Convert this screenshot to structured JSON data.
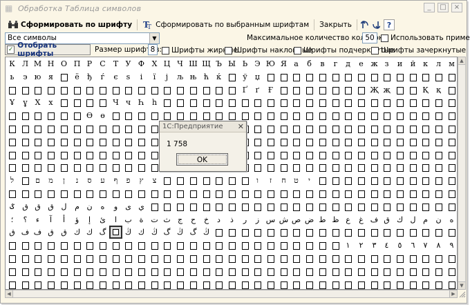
{
  "window": {
    "title": "Обработка  Таблица символов",
    "buttons": [
      "_",
      "□",
      "×"
    ]
  },
  "toolbar": {
    "generate_by_font_label": "Сформировать по шрифту",
    "generate_by_selected_label": "Сформировать по выбранным шрифтам",
    "close_label": "Закрыть",
    "help_label": "?"
  },
  "filter": {
    "symbols_combo_value": "Все символы",
    "max_columns_label": "Максимальное количество колонок:",
    "max_columns_value": "50",
    "use_note_label": "Использовать примечание",
    "select_fonts_label": "Отобрать шрифты",
    "font_size_label": "Размер шрифтов:",
    "font_size_value": "8",
    "bold_label": "Шрифты жирные",
    "italic_label": "Шрифты наклонные",
    "underline_label": "Шрифты подчеркнутые",
    "strike_label": "Шрифты зачеркнутые"
  },
  "grid": {
    "rows": [
      [
        "К",
        "Л",
        "М",
        "Н",
        "О",
        "П",
        "Р",
        "С",
        "Т",
        "У",
        "Ф",
        "Х",
        "Ц",
        "Ч",
        "Ш",
        "Щ",
        "Ъ",
        "Ы",
        "Ь",
        "Э",
        "Ю",
        "Я",
        "а",
        "б",
        "в",
        "г",
        "д",
        "е",
        "ж",
        "з",
        "и",
        "й",
        "к",
        "л",
        "м"
      ],
      [
        "ь",
        "э",
        "ю",
        "я",
        "□",
        "ё",
        "ђ",
        "ѓ",
        "є",
        "ѕ",
        "і",
        "ї",
        "ј",
        "љ",
        "њ",
        "ћ",
        "ќ",
        "□",
        "ў",
        "џ",
        "□",
        "□",
        "□",
        "□",
        "□",
        "□",
        "□",
        "□",
        "□",
        "□",
        "□",
        "□",
        "□",
        "□",
        "□"
      ],
      [
        "□",
        "□",
        "□",
        "□",
        "□",
        "□",
        "□",
        "□",
        "□",
        "□",
        "□",
        "□",
        "□",
        "□",
        "□",
        "□",
        "□",
        "□",
        "Ґ",
        "ґ",
        "Ғ",
        "□",
        "□",
        "□",
        "□",
        "□",
        "□",
        "□",
        "Җ",
        "җ",
        "□",
        "□",
        "Қ",
        "қ",
        "□"
      ],
      [
        "Ұ",
        "ұ",
        "Х",
        "х",
        "□",
        "□",
        "□",
        "□",
        "Ч",
        "ч",
        "Һ",
        "һ",
        "□",
        "□",
        "□",
        "□",
        "□",
        "□",
        "□",
        "□",
        "□",
        "□",
        "□",
        "□",
        "□",
        "□",
        "□",
        "□",
        "□",
        "□",
        "□",
        "□",
        "□",
        "□",
        "□"
      ],
      [
        "□",
        "□",
        "□",
        "□",
        "□",
        "□",
        "Ө",
        "ө",
        "□",
        "□",
        "□",
        "□",
        "□",
        "□",
        "□",
        "□",
        "□",
        "□",
        "□",
        "□",
        "□",
        "□",
        "□",
        "□",
        "□",
        "□",
        "□",
        "□",
        "□",
        "□",
        "□",
        "□",
        "□",
        "□",
        "□"
      ],
      [
        "□",
        "□",
        "□",
        "□",
        "□",
        "□",
        "□",
        "□",
        "□",
        "□",
        "□",
        "□",
        "□",
        "□",
        "□",
        "□",
        "□",
        "□",
        "□",
        "□",
        "□",
        "□",
        "□",
        "□",
        "□",
        "□",
        "□",
        "□",
        "□",
        "□",
        "□",
        "□",
        "□",
        "□",
        "□"
      ],
      [
        "□",
        "□",
        "□",
        "□",
        "□",
        "□",
        "□",
        "□",
        "□",
        "□",
        "□",
        "□",
        "□",
        "□",
        "□",
        "□",
        "□",
        "□",
        "□",
        "□",
        "□",
        "□",
        "□",
        "□",
        "□",
        "□",
        "□",
        "□",
        "□",
        "□",
        "□",
        "□",
        "□",
        "□",
        "□"
      ],
      [
        "□",
        "□",
        "□",
        "□",
        "□",
        "□",
        "□",
        "□",
        "□",
        "□",
        "□",
        "□",
        "□",
        "□",
        "□",
        "□",
        "□",
        "□",
        "□",
        "□",
        "□",
        "□",
        "□",
        "□",
        "□",
        "□",
        "□",
        "□",
        "□",
        "□",
        "□",
        "□",
        "□",
        "□",
        "□"
      ],
      [
        "□",
        "□",
        "□",
        "□",
        "□",
        "□",
        "□",
        "□",
        "□",
        "□",
        "□",
        "□",
        "□",
        "□",
        "□",
        "□",
        "□",
        "□",
        "□",
        "□",
        "□",
        "□",
        "□",
        "□",
        "□",
        "□",
        "□",
        "□",
        "□",
        "□",
        "□",
        "□",
        "□",
        "□",
        "□"
      ],
      [
        "ל",
        "□",
        "ם",
        "מ",
        "ן",
        "נ",
        "ס",
        "ע",
        "ף",
        "פ",
        "ץ",
        "צ",
        "□",
        "□",
        "□",
        "□",
        "□",
        "□",
        "□",
        "ו",
        "ז",
        "ח",
        "ט",
        "י",
        "□",
        "□",
        "□",
        "□",
        "□",
        "□",
        "□",
        "□",
        "□",
        "□",
        "□"
      ],
      [
        "□",
        "□",
        "□",
        "□",
        "□",
        "□",
        "□",
        "□",
        "□",
        "□",
        "□",
        "□",
        "□",
        "□",
        "□",
        "□",
        "□",
        "□",
        "□",
        "□",
        "□",
        "□",
        "□",
        "□",
        "□",
        "□",
        "□",
        "□",
        "□",
        "□",
        "□",
        "□",
        "□",
        "□",
        "□"
      ],
      [
        "ػ",
        "ق",
        "ق",
        "ق",
        "ل",
        "م",
        "ن",
        "ه",
        "و",
        "ى",
        "ي",
        "□",
        "□",
        "□",
        "□",
        "□",
        "□",
        "□",
        "□",
        "□",
        "□",
        "□",
        "□",
        "□",
        "□",
        "□",
        "□",
        "□",
        "□",
        "□",
        "□",
        "□",
        "□",
        "□",
        "□"
      ],
      [
        "؛",
        "؟",
        "ء",
        "آ",
        "أ",
        "ؤ",
        "إ",
        "ئ",
        "ا",
        "ب",
        "ة",
        "ت",
        "ث",
        "ج",
        "ح",
        "خ",
        "د",
        "ذ",
        "ر",
        "ز",
        "س",
        "ش",
        "ص",
        "ض",
        "ط",
        "ظ",
        "ع",
        "غ",
        "ف",
        "ق",
        "ك",
        "ل",
        "م",
        "ن",
        "ه"
      ],
      [
        "ق",
        "ف",
        "ف",
        "ق",
        "ق",
        "ك",
        "ك",
        "گ",
        "گ",
        "ڭ",
        "ك",
        "ڭ",
        "گ",
        "ڭ",
        "گ",
        "ڭ",
        "□",
        "□",
        "□",
        "□",
        "□",
        "□",
        "□",
        "□",
        "□",
        "□",
        "□",
        "□",
        "□",
        "□",
        "□",
        "□",
        "□",
        "□",
        "□"
      ],
      [
        "□",
        "□",
        "□",
        "□",
        "□",
        "□",
        "□",
        "□",
        "□",
        "□",
        "□",
        "□",
        "□",
        "□",
        "□",
        "□",
        "□",
        "□",
        "□",
        "□",
        "□",
        "□",
        "□",
        "□",
        "□",
        "□",
        "١",
        "٢",
        "٣",
        "٤",
        "٥",
        "٦",
        "٧",
        "٨",
        "٩"
      ],
      [
        "□",
        "□",
        "□",
        "□",
        "□",
        "□",
        "□",
        "□",
        "□",
        "□",
        "□",
        "□",
        "□",
        "□",
        "□",
        "□",
        "□",
        "□",
        "□",
        "□",
        "□",
        "□",
        "□",
        "□",
        "□",
        "□",
        "□",
        "□",
        "□",
        "□",
        "□",
        "□",
        "□",
        "□",
        "□"
      ],
      [
        "□",
        "□",
        "□",
        "□",
        "□",
        "□",
        "□",
        "□",
        "□",
        "□",
        "□",
        "□",
        "□",
        "□",
        "□",
        "□",
        "□",
        "□",
        "□",
        "□",
        "□",
        "□",
        "□",
        "□",
        "□",
        "□",
        "□",
        "□",
        "□",
        "□",
        "□",
        "□",
        "□",
        "□",
        "□"
      ],
      [
        "□",
        "□",
        "□",
        "□",
        "□",
        "□",
        "□",
        "□",
        "□",
        "□",
        "□",
        "□",
        "□",
        "□",
        "□",
        "□",
        "□",
        "□",
        "□",
        "□",
        "□",
        "□",
        "□",
        "□",
        "□",
        "□",
        "□",
        "□",
        "□",
        "□",
        "□",
        "□",
        "□",
        "□",
        "□"
      ]
    ],
    "selected": [
      13,
      8
    ]
  },
  "dialog": {
    "title": "1С:Предприятие",
    "message": "1 758",
    "ok_label": "OK",
    "close_glyph": "✕"
  }
}
